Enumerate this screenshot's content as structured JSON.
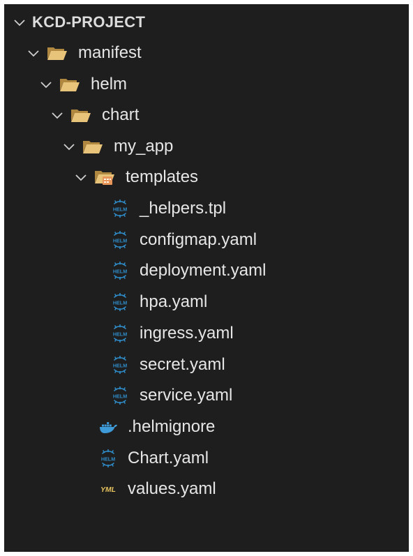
{
  "explorer": {
    "root": {
      "label": "KCD-PROJECT"
    },
    "folders": {
      "manifest": "manifest",
      "helm": "helm",
      "chart": "chart",
      "my_app": "my_app",
      "templates": "templates"
    },
    "template_files": [
      {
        "label": "_helpers.tpl",
        "icon": "helm-icon"
      },
      {
        "label": "configmap.yaml",
        "icon": "helm-icon"
      },
      {
        "label": "deployment.yaml",
        "icon": "helm-icon"
      },
      {
        "label": "hpa.yaml",
        "icon": "helm-icon"
      },
      {
        "label": "ingress.yaml",
        "icon": "helm-icon"
      },
      {
        "label": "secret.yaml",
        "icon": "helm-icon"
      },
      {
        "label": "service.yaml",
        "icon": "helm-icon"
      }
    ],
    "app_files": [
      {
        "label": ".helmignore",
        "icon": "docker-icon"
      },
      {
        "label": "Chart.yaml",
        "icon": "helm-icon"
      },
      {
        "label": "values.yaml",
        "icon": "yaml-icon"
      }
    ],
    "colors": {
      "background": "#1e1e1e",
      "text": "#e6e6e6",
      "folder": "#e8c47a",
      "helm": "#2f8cc8",
      "docker": "#3f9ad8",
      "yaml": "#e7c35e"
    }
  }
}
